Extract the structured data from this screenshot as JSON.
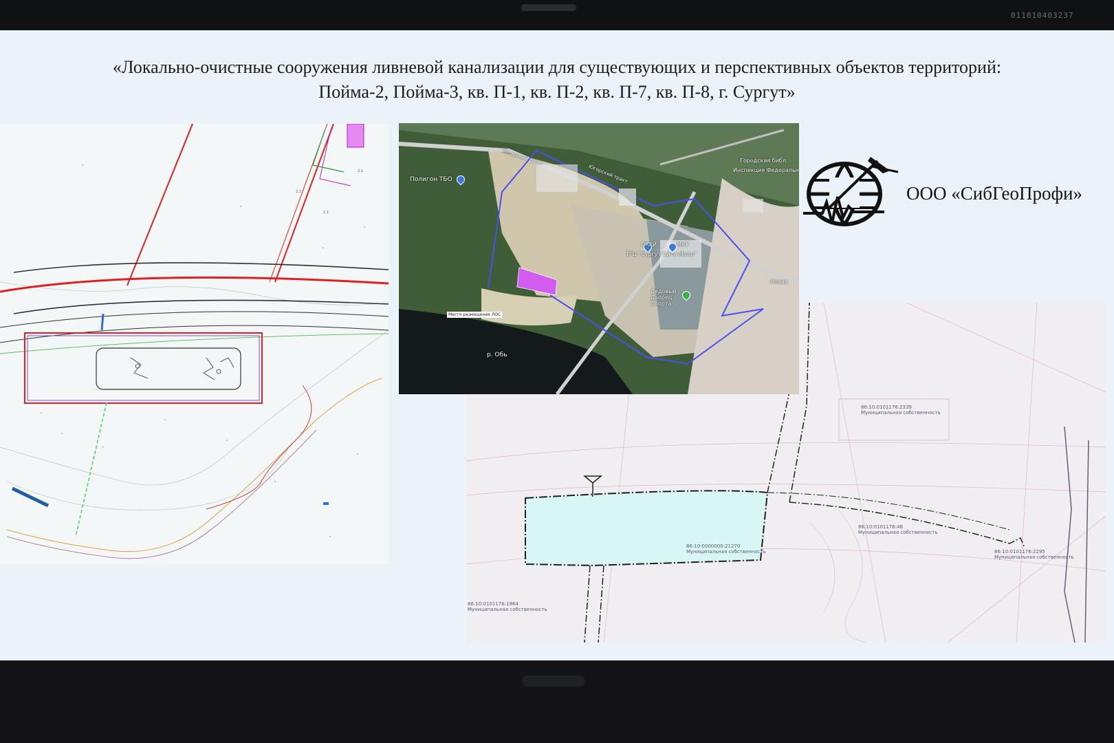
{
  "slide": {
    "title_line1": "«Локально-очистные сооружения ливневой канализации для существующих и перспективных объектов территорий:",
    "title_line2": "Пойма-2, Пойма-3, кв. П-1, кв. П-2, кв. П-7, кв. П-8, г. Сургут»",
    "company_name": "ООО «СибГеоПрофи»",
    "logo_icon": "globe-seismograph-logo-icon"
  },
  "monitor": {
    "serial_number": "011010403237"
  },
  "satellite_map": {
    "labels": {
      "landfill": "Полигон ТБО",
      "placement_note": "Место размещения ЛОС",
      "river": "р. Обь",
      "road_1": "Югорский тракт",
      "road_2": "Югорский тракт",
      "mall": "ТРЦ \"Сургут Сити Молл\"",
      "ice_palace": "Ледовый Дворец Спорта",
      "mku": "МКУ",
      "okei": "ОКЕЙ",
      "library": "Городская библ.",
      "inspection": "Инспекция Федеральной",
      "novaya": "Новая"
    },
    "colors": {
      "boundary": "#4a4ff0",
      "site": "#d35cf0"
    }
  },
  "cad_plan": {
    "parcels": [
      {
        "id": "86:10:0101176:2339",
        "owner": "Муниципальная собственность"
      },
      {
        "id": "86:10:0000000:21270",
        "owner": "Муниципальная собственность"
      },
      {
        "id": "86:10:0101176:46",
        "owner": "Муниципальная собственность"
      },
      {
        "id": "86:10:0101176:2295",
        "owner": "Муниципальная собственность"
      },
      {
        "id": "86:10:0101176:1964",
        "owner": "Муниципальная собственность"
      }
    ]
  }
}
